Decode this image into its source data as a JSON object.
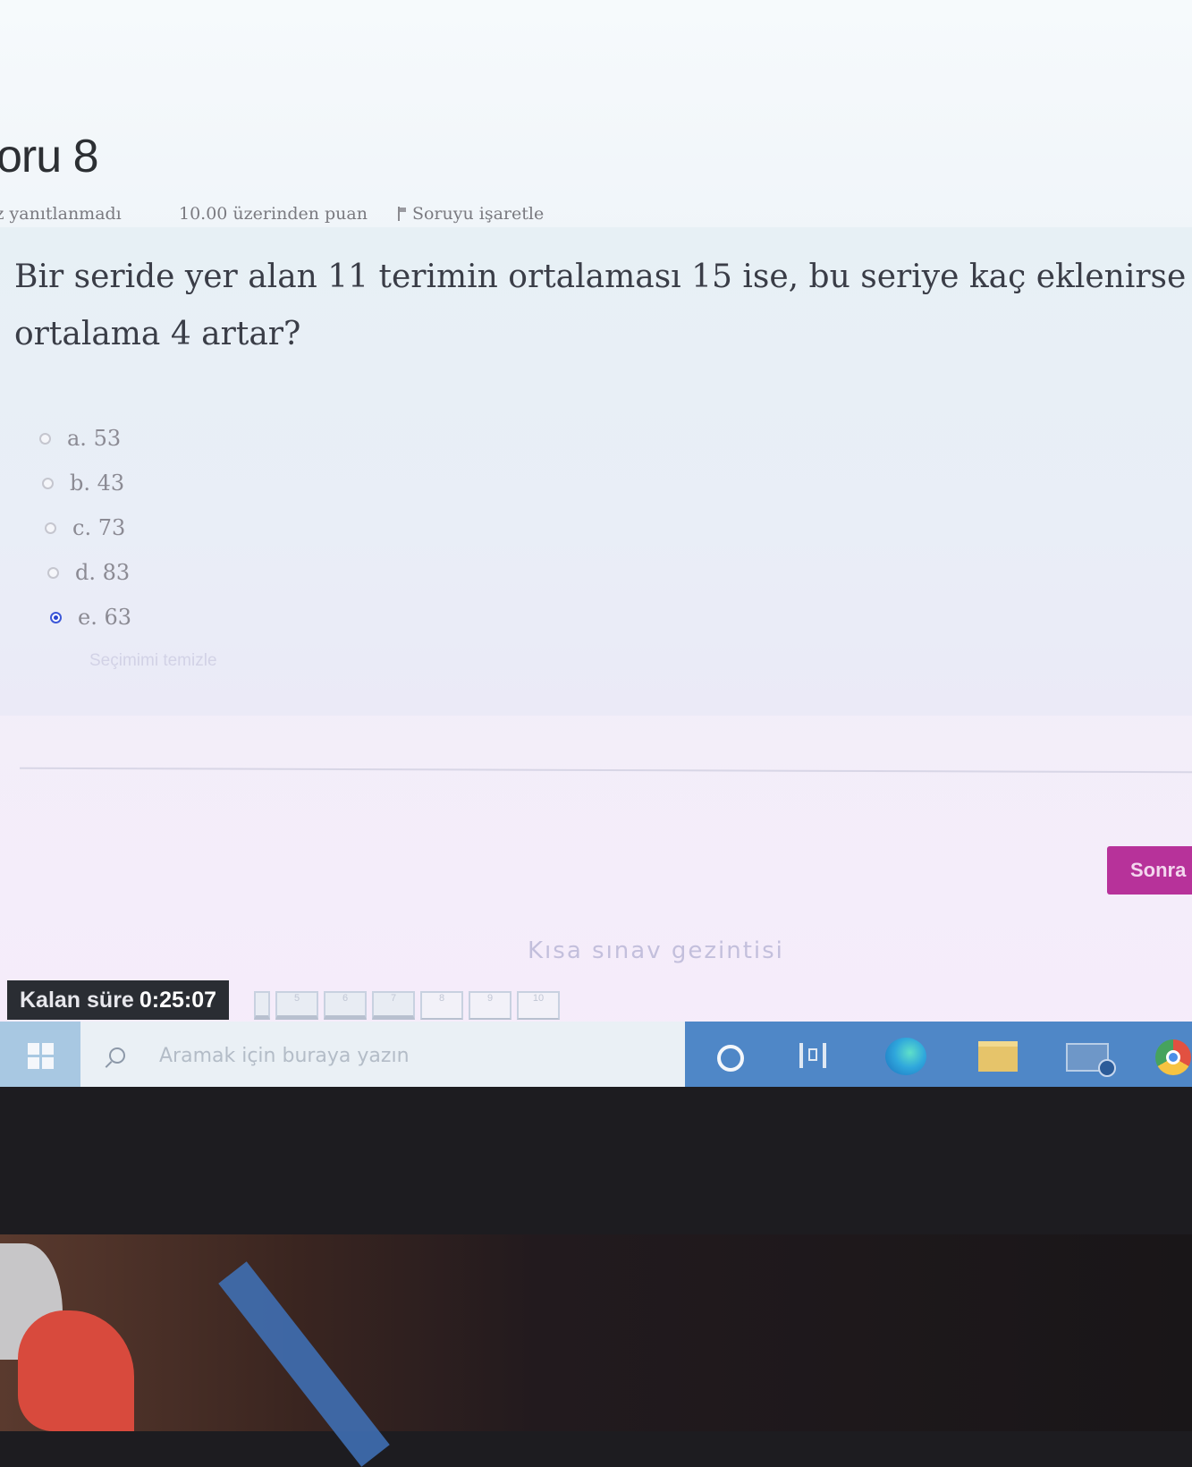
{
  "question": {
    "title": "oru 8",
    "status": "nüz yanıtlanmadı",
    "points": "10.00 üzerinden puan",
    "flag_label": "Soruyu işaretle",
    "text_line1": "Bir seride yer alan 11 terimin ortalaması 15 ise, bu seriye kaç eklenirse",
    "text_line2": "ortalama 4 artar?"
  },
  "answers": [
    {
      "label": "a. 53",
      "selected": false
    },
    {
      "label": "b. 43",
      "selected": false
    },
    {
      "label": "c. 73",
      "selected": false
    },
    {
      "label": "d. 83",
      "selected": false
    },
    {
      "label": "e. 63",
      "selected": true
    }
  ],
  "clear_choice": "Seçimimi temizle",
  "next_button": "Sonra",
  "quiz_navigation": "Kısa sınav gezintisi",
  "timer": {
    "label": "Kalan süre",
    "value": "0:25:07"
  },
  "question_nav": [
    "",
    "5",
    "6",
    "7",
    "8",
    "9",
    "10"
  ],
  "taskbar": {
    "search_placeholder": "Aramak için buraya yazın"
  },
  "colors": {
    "next_button": "#b7329a",
    "taskbar": "#4f87c7",
    "selected_radio": "#2b46d0"
  }
}
